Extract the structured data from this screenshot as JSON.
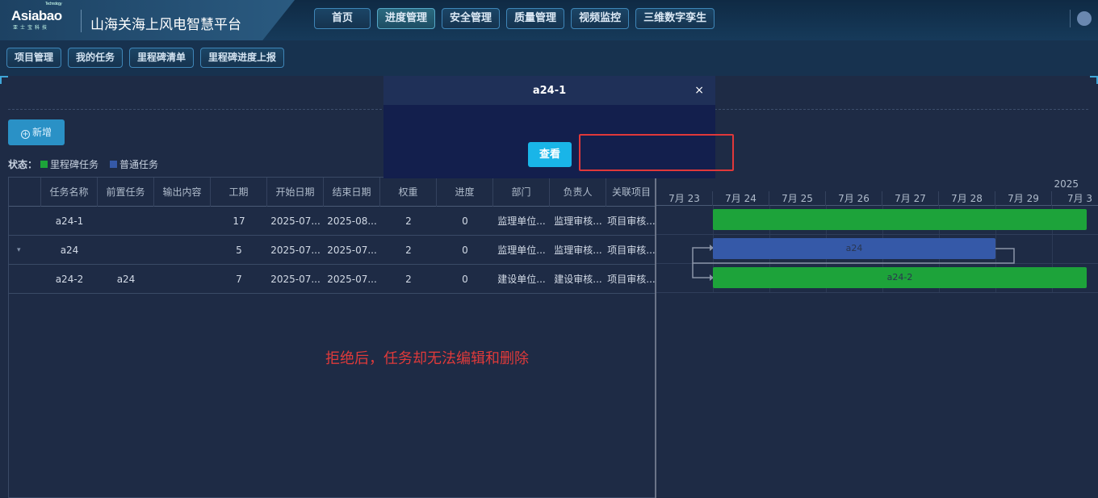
{
  "header": {
    "logo_text": "Asiabao",
    "logo_small": "Technology",
    "logo_sub": "亚士宝科技",
    "title": "山海关海上风电智慧平台",
    "tabs": [
      {
        "label": "首页"
      },
      {
        "label": "进度管理"
      },
      {
        "label": "安全管理"
      },
      {
        "label": "质量管理"
      },
      {
        "label": "视频监控"
      },
      {
        "label": "三维数字孪生"
      }
    ]
  },
  "subnav": {
    "items": [
      {
        "label": "项目管理"
      },
      {
        "label": "我的任务"
      },
      {
        "label": "里程碑清单"
      },
      {
        "label": "里程碑进度上报"
      }
    ]
  },
  "toolbar": {
    "add_label": "新增",
    "add_icon": "plus-circle-icon"
  },
  "legend": {
    "label": "状态：",
    "items": [
      {
        "label": "里程碑任务",
        "color": "#1da33a"
      },
      {
        "label": "普通任务",
        "color": "#3559a8"
      }
    ]
  },
  "grid": {
    "columns": [
      "任务名称",
      "前置任务",
      "输出内容",
      "工期",
      "开始日期",
      "结束日期",
      "权重",
      "进度",
      "部门",
      "负责人",
      "关联项目"
    ],
    "rows": [
      {
        "name": "a24-1",
        "pre": "",
        "output": "",
        "duration": "17",
        "start": "2025-07...",
        "end": "2025-08...",
        "weight": "2",
        "progress": "0",
        "dept": "监理单位...",
        "owner": "监理审核...",
        "project": "项目审核..."
      },
      {
        "name": "a24",
        "pre": "",
        "output": "",
        "duration": "5",
        "start": "2025-07...",
        "end": "2025-07...",
        "weight": "2",
        "progress": "0",
        "dept": "监理单位...",
        "owner": "监理审核...",
        "project": "项目审核..."
      },
      {
        "name": "a24-2",
        "pre": "a24",
        "output": "",
        "duration": "7",
        "start": "2025-07...",
        "end": "2025-07...",
        "weight": "2",
        "progress": "0",
        "dept": "建设单位...",
        "owner": "建设审核...",
        "project": "项目审核..."
      }
    ]
  },
  "gantt": {
    "year": "2025",
    "days": [
      "7月 23",
      "7月 24",
      "7月 25",
      "7月 26",
      "7月 27",
      "7月 28",
      "7月 29",
      "7月 3"
    ],
    "bars": [
      {
        "label": "",
        "color": "#1da33a"
      },
      {
        "label": "a24",
        "color": "#3559a8"
      },
      {
        "label": "a24-2",
        "color": "#1da33a"
      }
    ]
  },
  "note": "拒绝后，任务却无法编辑和删除",
  "modal": {
    "title": "a24-1",
    "close": "×",
    "view_label": "查看"
  }
}
